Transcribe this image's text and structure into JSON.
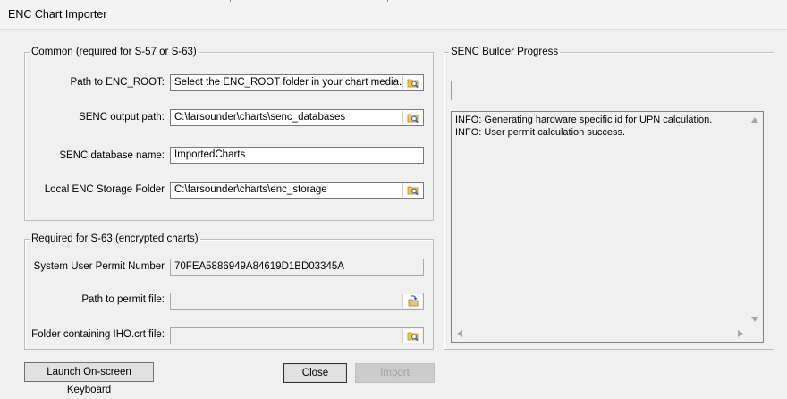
{
  "window": {
    "title": "ENC Chart Importer"
  },
  "common": {
    "legend": "Common (required for S-57 or S-63)",
    "enc_root": {
      "label": "Path to ENC_ROOT:",
      "value": "Select the ENC_ROOT folder in your chart media."
    },
    "senc_output": {
      "label": "SENC output path:",
      "value": "C:\\farsounder\\charts\\senc_databases"
    },
    "senc_db_name": {
      "label": "SENC database name:",
      "value": "ImportedCharts"
    },
    "local_storage": {
      "label": "Local ENC Storage Folder",
      "value": "C:\\farsounder\\charts\\enc_storage"
    }
  },
  "s63": {
    "legend": "Required for S-63 (encrypted charts)",
    "user_permit": {
      "label": "System User Permit Number",
      "value": "70FEA5886949A84619D1BD03345A"
    },
    "permit_file": {
      "label": "Path to permit file:",
      "value": ""
    },
    "iho_folder": {
      "label": "Folder containing IHO.crt file:",
      "value": ""
    }
  },
  "progress": {
    "legend": "SENC Builder Progress",
    "log": [
      "INFO: Generating hardware specific id for UPN calculation.",
      "INFO: User permit calculation success."
    ]
  },
  "buttons": {
    "keyboard": "Launch On-screen Keyboard",
    "close": "Close",
    "import": "Import"
  },
  "icons": {
    "browse_folder": "folder-search-icon",
    "open_file": "open-file-icon"
  }
}
